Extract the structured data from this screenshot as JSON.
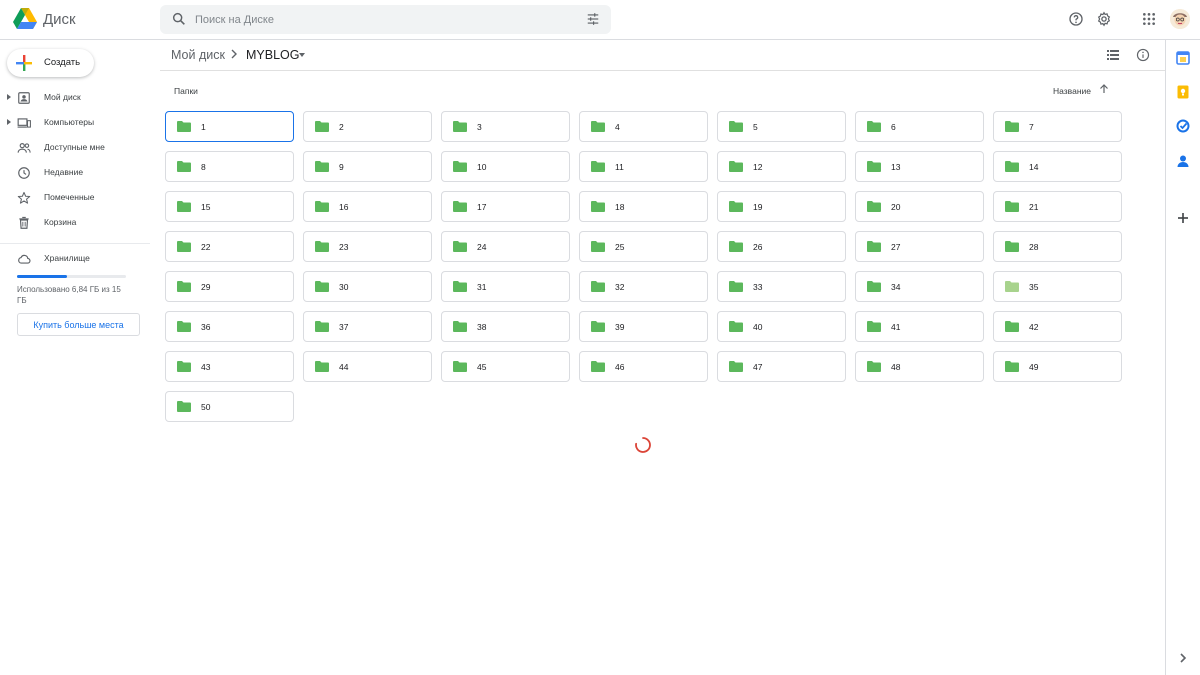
{
  "header": {
    "app_title": "Диск",
    "search_placeholder": "Поиск на Диске"
  },
  "sidebar": {
    "create_label": "Создать",
    "items": [
      {
        "label": "Мой диск",
        "icon": "my-drive-icon"
      },
      {
        "label": "Компьютеры",
        "icon": "computers-icon"
      },
      {
        "label": "Доступные мне",
        "icon": "shared-icon"
      },
      {
        "label": "Недавние",
        "icon": "recent-icon"
      },
      {
        "label": "Помеченные",
        "icon": "star-icon"
      },
      {
        "label": "Корзина",
        "icon": "trash-icon"
      }
    ],
    "storage": {
      "label": "Хранилище",
      "used_text": "Использовано 6,84 ГБ из 15 ГБ",
      "used_fraction": 0.456,
      "buy_label": "Купить больше места"
    }
  },
  "breadcrumb": {
    "root": "Мой диск",
    "current": "MYBLOG"
  },
  "main": {
    "section_label": "Папки",
    "sort_label": "Название",
    "folders": [
      "1",
      "2",
      "3",
      "4",
      "5",
      "6",
      "7",
      "8",
      "9",
      "10",
      "11",
      "12",
      "13",
      "14",
      "15",
      "16",
      "17",
      "18",
      "19",
      "20",
      "21",
      "22",
      "23",
      "24",
      "25",
      "26",
      "27",
      "28",
      "29",
      "30",
      "31",
      "32",
      "33",
      "34",
      "35",
      "36",
      "37",
      "38",
      "39",
      "40",
      "41",
      "42",
      "43",
      "44",
      "45",
      "46",
      "47",
      "48",
      "49",
      "50"
    ],
    "selected_folder": "1"
  },
  "colors": {
    "accent": "#1a73e8",
    "folder": "#5cb85c",
    "folder_light": "#a8d38d",
    "spinner": "#db4437"
  }
}
